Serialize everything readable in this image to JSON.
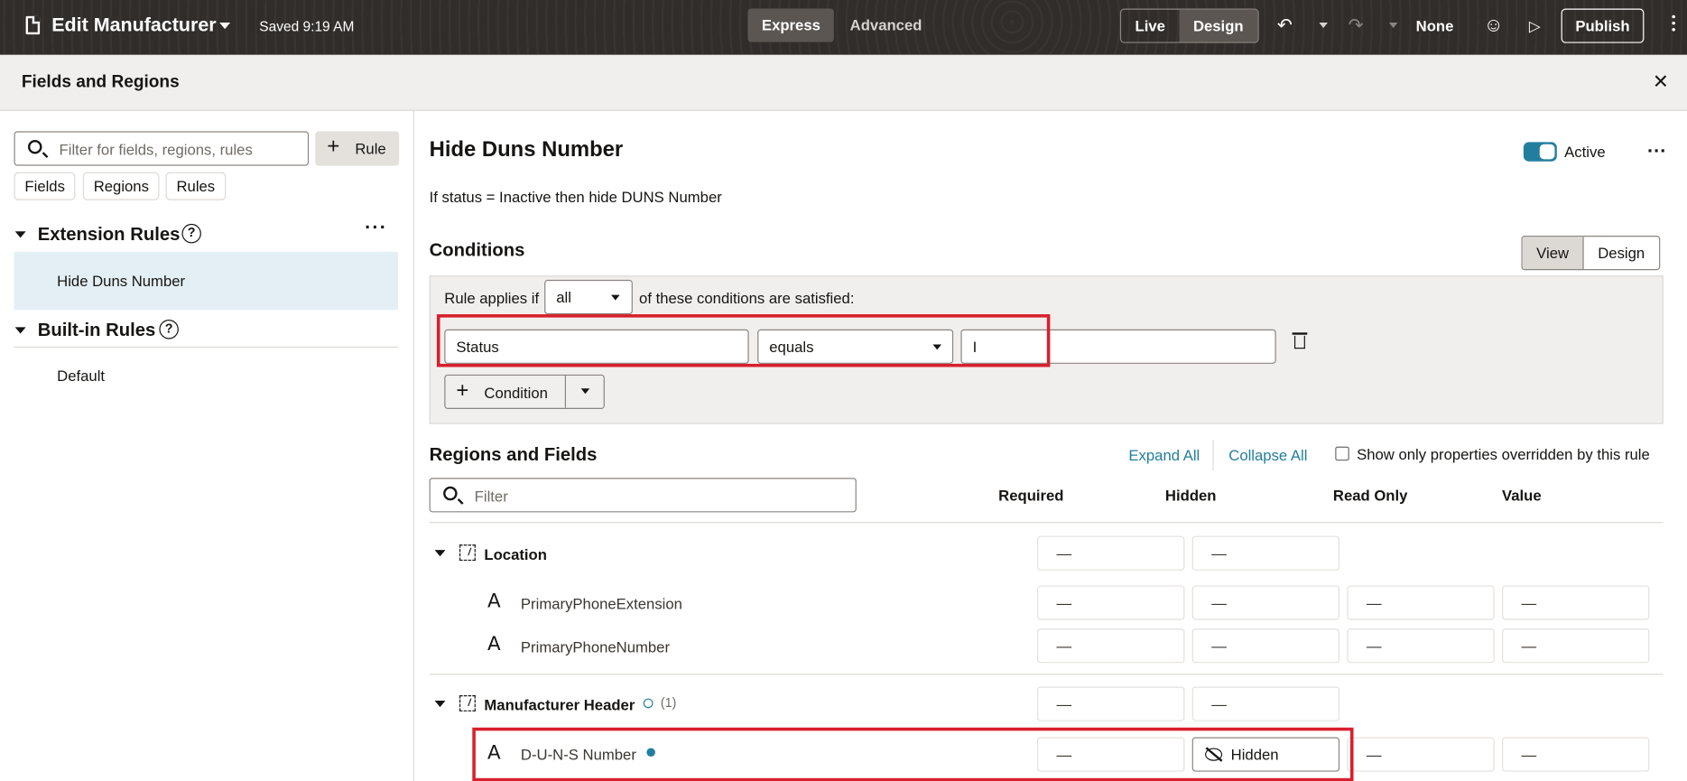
{
  "topbar": {
    "title": "Edit Manufacturer",
    "saved": "Saved 9:19 AM",
    "modes": [
      "Express",
      "Advanced"
    ],
    "live": "Live",
    "design": "Design",
    "none": "None",
    "publish": "Publish"
  },
  "drawer": {
    "title": "Fields and Regions"
  },
  "left": {
    "filter_placeholder": "Filter for fields, regions, rules",
    "rule_button": "Rule",
    "chips": [
      "Fields",
      "Regions",
      "Rules"
    ],
    "extension_rules": "Extension Rules",
    "extension_items": [
      "Hide Duns Number"
    ],
    "builtin_rules": "Built-in Rules",
    "builtin_items": [
      "Default"
    ]
  },
  "rule": {
    "title": "Hide Duns Number",
    "active_label": "Active",
    "description": "If status = Inactive then hide DUNS Number",
    "conditions_title": "Conditions",
    "view": "View",
    "design": "Design",
    "applies_prefix": "Rule applies if",
    "applies_value": "all",
    "applies_suffix": "of these conditions are satisfied:",
    "condition": {
      "field": "Status",
      "operator": "equals",
      "value": "I"
    },
    "add_condition": "Condition"
  },
  "regions": {
    "title": "Regions and Fields",
    "expand_all": "Expand All",
    "collapse_all": "Collapse All",
    "show_only": "Show only properties overridden by this rule",
    "filter_placeholder": "Filter",
    "columns": [
      "Required",
      "Hidden",
      "Read Only",
      "Value"
    ],
    "dash": "—",
    "location": "Location",
    "fields_location": [
      "PrimaryPhoneExtension",
      "PrimaryPhoneNumber"
    ],
    "manufacturer_header": "Manufacturer Header",
    "mh_count": "(1)",
    "duns": "D-U-N-S Number",
    "hidden_btn": "Hidden"
  },
  "colors": {
    "accent": "#227e9e",
    "highlight": "#d8202d",
    "topbar": "#312d2a"
  }
}
